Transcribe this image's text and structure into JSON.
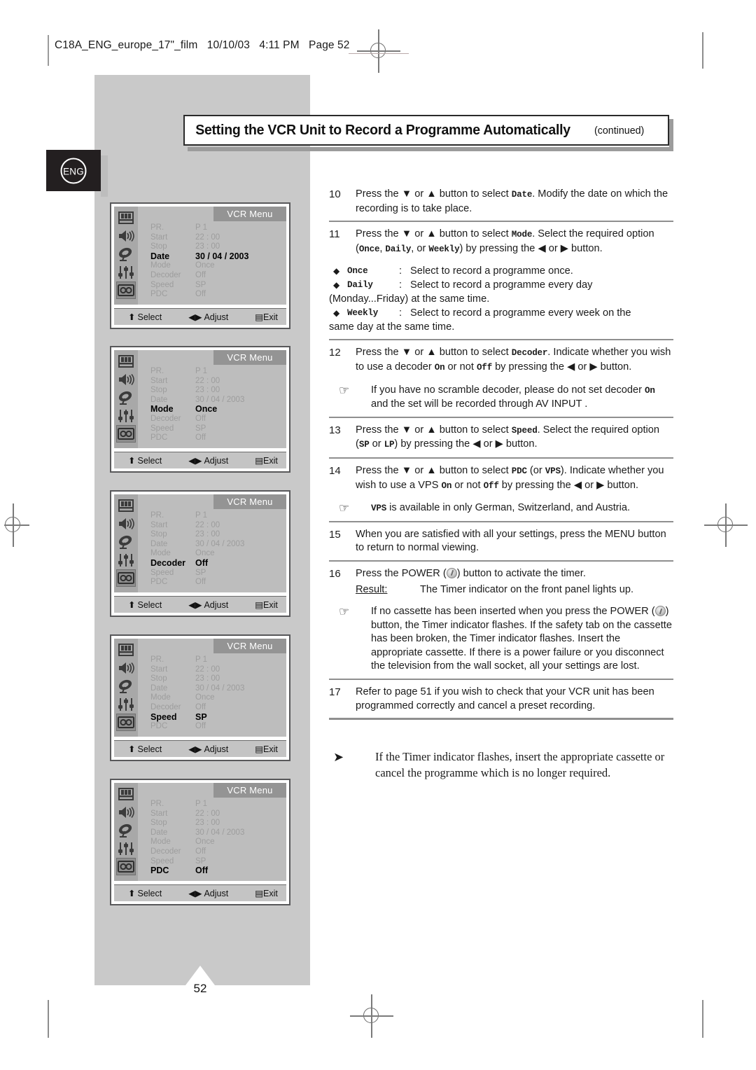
{
  "printhead": {
    "filename": "C18A_ENG_europe_17\"_film",
    "date": "10/10/03",
    "time": "4:11 PM",
    "page_label": "Page 52"
  },
  "lang_tab": {
    "label": "ENG"
  },
  "title": {
    "main": "Setting the VCR Unit to Record a Programme Automatically",
    "continued": "(continued)"
  },
  "page_number": "52",
  "menu_common": {
    "screen_title": "VCR Menu",
    "icons": [
      "picture-icon",
      "sound-icon",
      "satellite-icon",
      "setup-sliders-icon",
      "vcr-cassette-icon"
    ],
    "rows": [
      {
        "label": "PR.",
        "value": "P  1"
      },
      {
        "label": "Start",
        "value": "22 : 00"
      },
      {
        "label": "Stop",
        "value": "23 : 00"
      },
      {
        "label": "Date",
        "value": "30 / 04 / 2003"
      },
      {
        "label": "Mode",
        "value": "Once"
      },
      {
        "label": "Decoder",
        "value": "Off"
      },
      {
        "label": "Speed",
        "value": "SP"
      },
      {
        "label": "PDC",
        "value": "Off"
      }
    ],
    "bottom_bar": {
      "select": "Select",
      "adjust": "Adjust",
      "exit": "Exit"
    }
  },
  "menus": [
    {
      "name": "menu-date",
      "highlight_index": 3
    },
    {
      "name": "menu-mode",
      "highlight_index": 4
    },
    {
      "name": "menu-decoder",
      "highlight_index": 5
    },
    {
      "name": "menu-speed",
      "highlight_index": 6
    },
    {
      "name": "menu-pdc",
      "highlight_index": 7
    }
  ],
  "steps": {
    "s10": {
      "num": "10",
      "p1": "Press the ▼ or ▲ button to select ",
      "k1": "Date",
      "p2": ". Modify the date on which the recording is to take place."
    },
    "s11": {
      "num": "11",
      "p1": "Press the ▼ or ▲ button to select ",
      "k1": "Mode",
      "p2": ". Select the required option (",
      "k2": "Once",
      "p3": ", ",
      "k3": "Daily",
      "p4": ", or ",
      "k4": "Weekly",
      "p5": ") by pressing the ◀ or ▶ button.",
      "bullets": [
        {
          "key": "Once",
          "colon": ":",
          "text": "Select to record a programme once.",
          "cont": ""
        },
        {
          "key": "Daily",
          "colon": ":",
          "text": "Select to record a programme every day",
          "cont": "(Monday...Friday) at the same time."
        },
        {
          "key": "Weekly",
          "colon": ":",
          "text": "Select to record a programme every week on the",
          "cont": "same day at the same time."
        }
      ]
    },
    "s12": {
      "num": "12",
      "p1": "Press the ▼ or ▲ button to select ",
      "k1": "Decoder",
      "p2": ". Indicate whether you wish to use a decoder ",
      "k2": "On",
      "p3": " or not ",
      "k3": "Off",
      "p4": " by pressing the ◀ or ▶ button.",
      "note_a": "If you have no scramble decoder, please do not set decoder ",
      "note_k": "On",
      "note_b": "  and the set will be recorded through  AV INPUT ."
    },
    "s13": {
      "num": "13",
      "p1": "Press the ▼ or ▲ button to select ",
      "k1": "Speed",
      "p2": ". Select the required option (",
      "k2": "SP",
      "p3": " or ",
      "k3": "LP",
      "p4": ") by pressing the ◀ or ▶ button."
    },
    "s14": {
      "num": "14",
      "p1": "Press the ▼ or ▲ button to select ",
      "k1": "PDC",
      "p2": " (or ",
      "k2": "VPS",
      "p3": "). Indicate whether you wish to use a VPS ",
      "k3": "On",
      "p4": " or not ",
      "k4": "Off",
      "p5": " by pressing the ◀ or ▶ button.",
      "note_k": "VPS",
      "note_b": "  is available in only German, Switzerland, and Austria."
    },
    "s15": {
      "num": "15",
      "p1": "When you are satisfied with all your settings, press the MENU button to return to normal viewing."
    },
    "s16": {
      "num": "16",
      "p1": "Press the POWER (",
      "p2": ") button to activate the timer.",
      "result_label": "Result:",
      "result_text": "The Timer indicator on the front panel lights up.",
      "note_a": "If no cassette has been inserted when you press the POWER (",
      "note_b": ") button, the Timer indicator flashes. If the safety tab on the cassette has been broken, the Timer indicator flashes. Insert the appropriate cassette. If there is a power failure or you disconnect the television from the wall socket, all your settings are lost."
    },
    "s17": {
      "num": "17",
      "p1": "Refer to page 51 if you wish to check that your VCR unit has been programmed correctly and cancel a preset recording."
    }
  },
  "final_note": {
    "arrow": "➤",
    "text": "If the Timer indicator flashes, insert the appropriate cassette or cancel the programme which is no longer required."
  }
}
